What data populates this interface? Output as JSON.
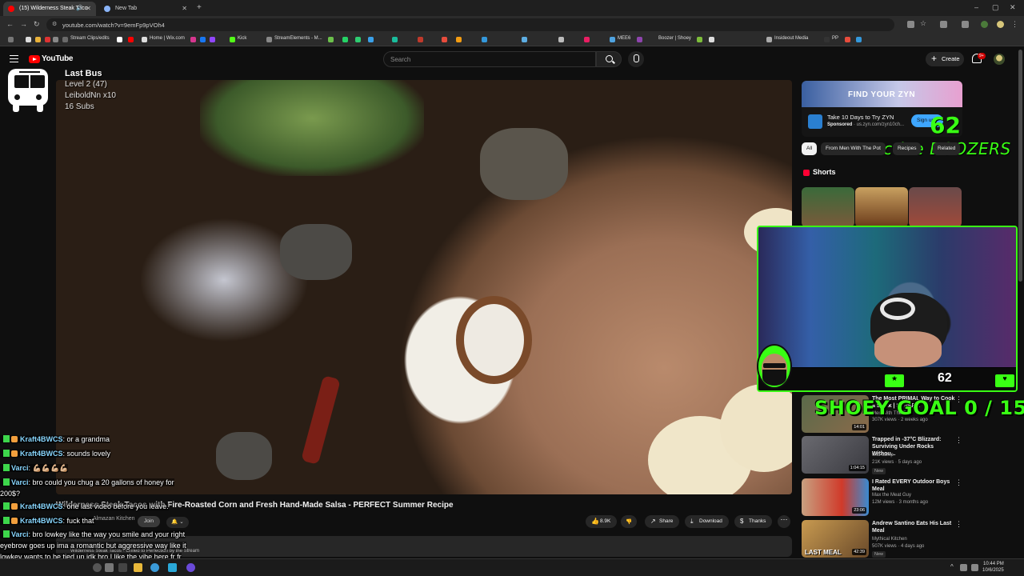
{
  "browser": {
    "tabs": [
      {
        "label": "(15) Wilderness Steak Taco",
        "active": true
      },
      {
        "label": "New Tab",
        "active": false
      }
    ],
    "url": "youtube.com/watch?v=9emFp9pVOh4",
    "bookmarks": [
      "Stream Clips/edits",
      "Home | Wix.com",
      "Kick",
      "StreamElements - M...",
      "MEE6",
      "Boozer | Shoey",
      "Insideout Media",
      "PP"
    ]
  },
  "youtube": {
    "logo": "YouTube",
    "search_placeholder": "Search",
    "create_label": "Create",
    "notif_badge": "9+"
  },
  "overlay": {
    "bus_title": "Last Bus",
    "bus_lines": [
      "Level 2 (47)",
      "LeiboldNn x10",
      "16 Subs"
    ],
    "boozers_count": "62",
    "boozers_label": "Active BOOZERS",
    "goal": "SHOEY GOAL 0 / 15",
    "webcam_count": "62"
  },
  "video": {
    "title": "Wilderness Steak Tacos with Fire-Roasted Corn and Fresh Hand-Made Salsa - PERFECT Summer Recipe",
    "channel_sub": "Almazan Kitchen",
    "join_label": "Join",
    "likes": "8.9K",
    "share_label": "Share",
    "download_label": "Download",
    "thanks_label": "Thanks",
    "description_preview": "Wilderness Steak Tacos - Grilled to Perfection by the Stream",
    "subscribed_bell": "🔔 ⌄"
  },
  "chat": [
    {
      "user": "Kraft4BWCS",
      "text": ": or a grandma"
    },
    {
      "user": "Kraft4BWCS",
      "text": ": sounds lovely"
    },
    {
      "user": "Varci",
      "text": ": 💪🏼💪🏼💪🏼💪🏼"
    },
    {
      "user": "Varci",
      "text": ": bro could you chug a 20 gallons of honey for 200$?"
    },
    {
      "user": "Kraft4BWCS",
      "text": ": one last video before you leave."
    },
    {
      "user": "Kraft4BWCS",
      "text": ": fuck that"
    },
    {
      "user": "Varci",
      "text": ": bro lowkey like the way you smile and your right eyebrow goes up ima a romantic but aggressive way like it lowkey wants to be tied up idk bro I like the vibe here fr fr"
    }
  ],
  "sidebar": {
    "ad": {
      "banner": "FIND YOUR ZYN",
      "title": "Take 10 Days to Try ZYN",
      "sponsored": "Sponsored",
      "domain": "· us.zyn.com/zyn10ch...",
      "signup": "Sign up"
    },
    "chips": [
      "All",
      "From Men With The Pot",
      "Recipes",
      "Related"
    ],
    "shorts_label": "Shorts",
    "recs": [
      {
        "title": "The Most PRIMAL Way to Cook a Steak | SUPER...",
        "channel": "Men With The Pot",
        "meta": "307K views · 2 weeks ago",
        "duration": "14:01"
      },
      {
        "title": "Trapped in -37°C Blizzard: Surviving Under Rocks Withou...",
        "channel": "wild camp",
        "meta": "21K views · 5 days ago",
        "duration": "1:04:15",
        "badge": "New"
      },
      {
        "title": "I Rated EVERY Outdoor Boys Meal",
        "channel": "Max the Meat Guy",
        "meta": "12M views · 3 months ago",
        "duration": "23:06"
      },
      {
        "title": "Andrew Santino Eats His Last Meal",
        "channel": "Mythical Kitchen",
        "meta": "507K views · 4 days ago",
        "duration": "42:39",
        "badge": "New",
        "thumb_text": "LAST MEAL"
      }
    ]
  },
  "taskbar": {
    "time": "10:44 PM",
    "date": "10/6/2025"
  }
}
